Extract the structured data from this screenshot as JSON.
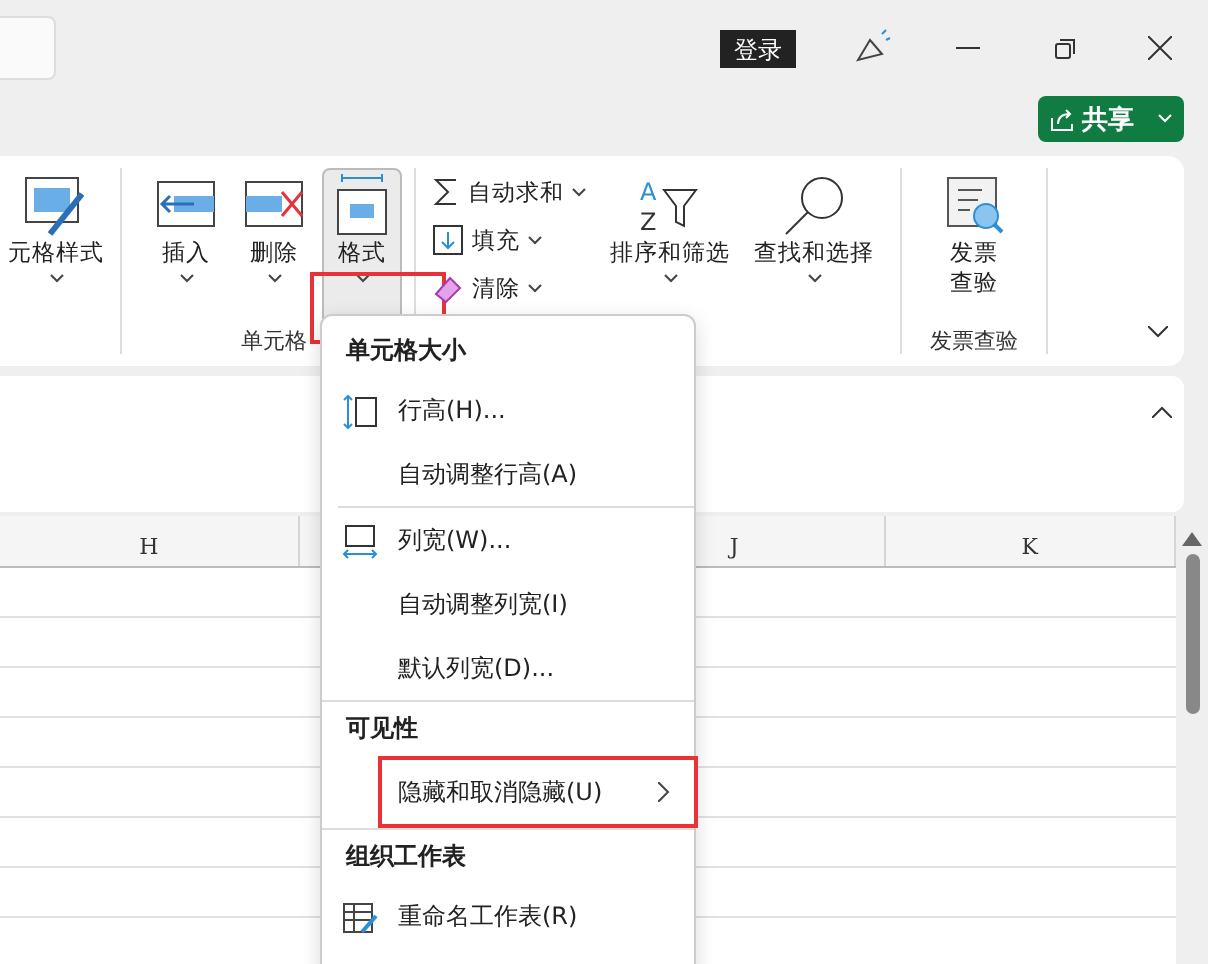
{
  "titlebar": {
    "login": "登录",
    "share": "共享"
  },
  "ribbon": {
    "groups": [
      {
        "kind": "partial",
        "buttons": [
          {
            "label": "元格样式",
            "pressed": false,
            "highlighted": false
          }
        ]
      },
      {
        "kind": "cells",
        "label": "单元格",
        "buttons": [
          {
            "label": "插入",
            "pressed": false,
            "highlighted": false
          },
          {
            "label": "删除",
            "pressed": false,
            "highlighted": false
          },
          {
            "label": "格式",
            "pressed": true,
            "highlighted": true
          }
        ]
      },
      {
        "kind": "edit",
        "small": [
          {
            "label": "自动求和"
          },
          {
            "label": "填充"
          },
          {
            "label": "清除"
          }
        ],
        "buttons": [
          {
            "label": "排序和筛选",
            "pressed": false,
            "highlighted": false,
            "icon_letters": [
              "A",
              "Z"
            ]
          },
          {
            "label": "查找和选择",
            "pressed": false,
            "highlighted": false
          }
        ]
      },
      {
        "kind": "invoice",
        "label": "发票查验",
        "buttons": [
          {
            "label": "发票查验",
            "pressed": false,
            "highlighted": false
          }
        ]
      }
    ]
  },
  "sheet": {
    "columns": [
      "H",
      "J",
      "K"
    ]
  },
  "menu": {
    "sections": [
      {
        "title": "单元格大小",
        "items": [
          {
            "label": "行高(H)...",
            "submenu": false,
            "highlighted": false
          },
          {
            "label": "自动调整行高(A)",
            "submenu": false,
            "highlighted": false
          }
        ]
      },
      {
        "items": [
          {
            "label": "列宽(W)...",
            "submenu": false,
            "highlighted": false
          },
          {
            "label": "自动调整列宽(I)",
            "submenu": false,
            "highlighted": false
          },
          {
            "label": "默认列宽(D)...",
            "submenu": false,
            "highlighted": false
          }
        ]
      },
      {
        "title": "可见性",
        "items": [
          {
            "label": "隐藏和取消隐藏(U)",
            "submenu": true,
            "highlighted": true
          }
        ]
      },
      {
        "title": "组织工作表",
        "items": [
          {
            "label": "重命名工作表(R)",
            "submenu": false,
            "highlighted": false
          }
        ]
      }
    ]
  }
}
